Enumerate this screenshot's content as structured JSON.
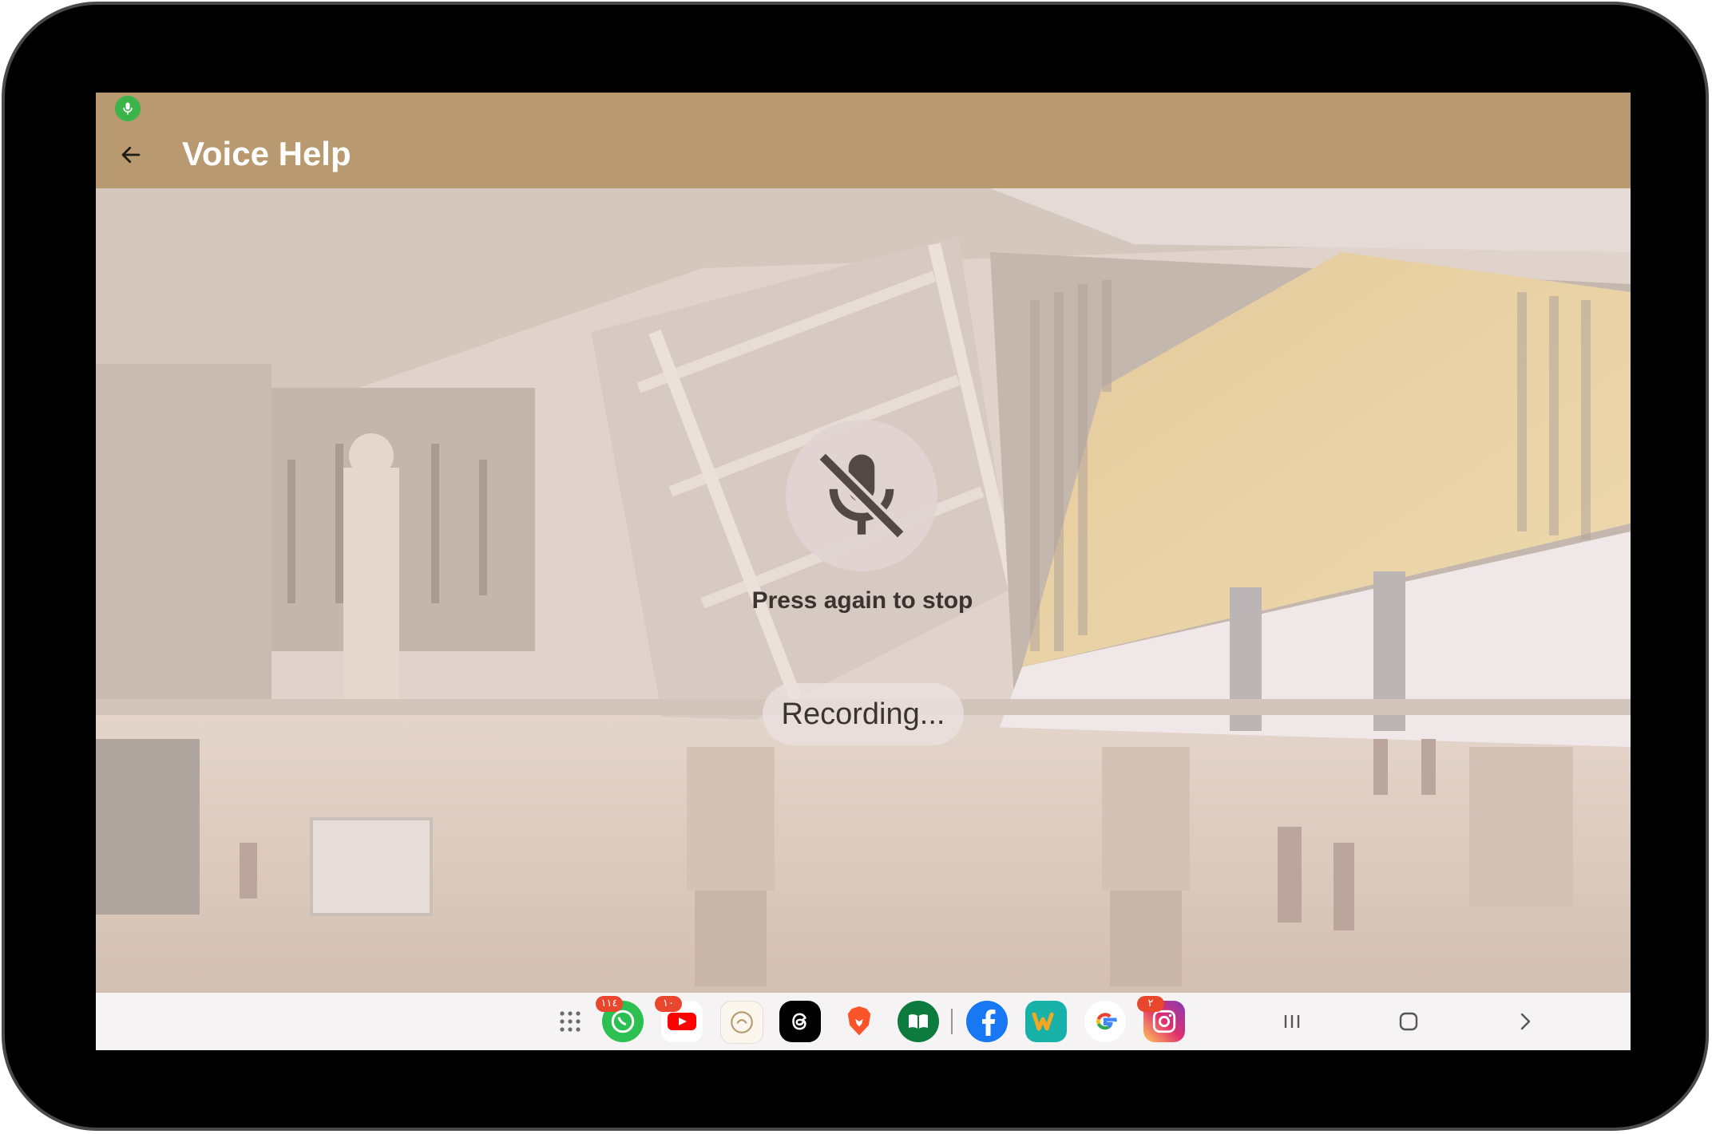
{
  "status_bar": {
    "indicator_icon": "microphone-icon",
    "indicator_color": "#3bb54a"
  },
  "app_bar": {
    "title": "Voice Help",
    "back_icon": "arrow-left-icon",
    "background": "#b9996f"
  },
  "voice": {
    "mic_icon": "microphone-off-icon",
    "hint": "Press again to stop",
    "status": "Recording..."
  },
  "taskbar": {
    "apps": [
      {
        "name": "app-drawer",
        "icon": "grid-icon"
      },
      {
        "name": "whatsapp",
        "icon": "whatsapp-icon",
        "badge": "١١٤"
      },
      {
        "name": "youtube",
        "icon": "youtube-icon",
        "badge": "١٠"
      },
      {
        "name": "quran",
        "icon": "quran-icon"
      },
      {
        "name": "threads",
        "icon": "threads-icon"
      },
      {
        "name": "brave",
        "icon": "brave-icon"
      },
      {
        "name": "quran-reader",
        "icon": "book-icon"
      },
      {
        "name": "facebook",
        "icon": "facebook-icon"
      },
      {
        "name": "wattpad",
        "icon": "wattpad-icon"
      },
      {
        "name": "google",
        "icon": "google-icon"
      },
      {
        "name": "instagram",
        "icon": "instagram-icon",
        "badge": "٢"
      }
    ],
    "nav": [
      "recents-icon",
      "home-icon",
      "back-chevron-icon"
    ]
  }
}
